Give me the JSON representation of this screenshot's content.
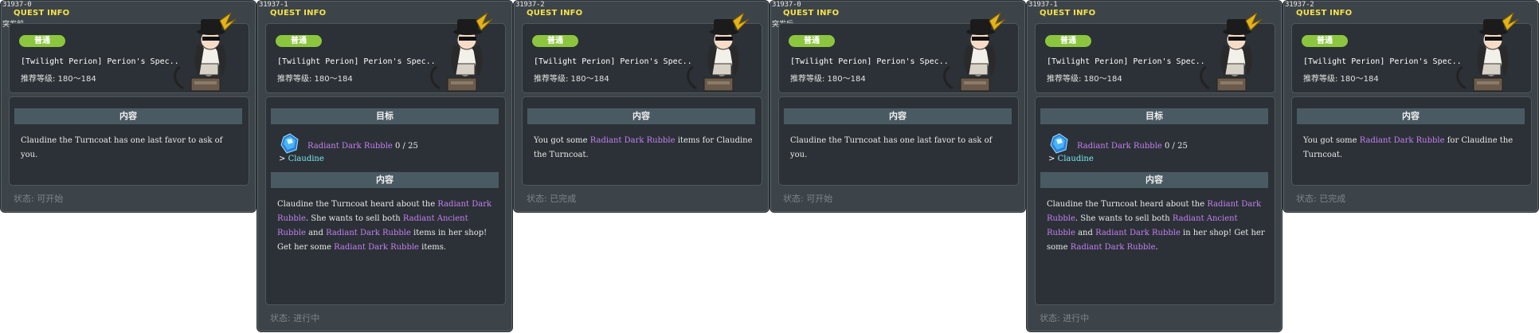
{
  "panels": [
    {
      "id": "31937-0",
      "title": "QUEST INFO",
      "tag": "突发前",
      "badge": "普通",
      "quest_name": "[Twilight Perion] Perion's Spec..",
      "level": "推荐等级: 180～184",
      "content_header": "内容",
      "description": "Claudine the Turncoat has one last favor to ask of you.",
      "status": "状态: 可开始"
    },
    {
      "id": "31937-1",
      "title": "QUEST INFO",
      "badge": "普通",
      "quest_name": "[Twilight Perion] Perion's Spec..",
      "level": "推荐等级: 180～184",
      "target_header": "目标",
      "item_name": "Radiant Dark Rubble",
      "item_count": "0 / 25",
      "npc_prefix": "> ",
      "npc_name": "Claudine",
      "content_header": "内容",
      "description_parts": [
        {
          "t": "Claudine the Turncoat heard about the ",
          "hl": false
        },
        {
          "t": "Radiant Dark Rubble",
          "hl": true
        },
        {
          "t": ". She wants to sell both ",
          "hl": false
        },
        {
          "t": "Radiant Ancient Rubble",
          "hl": true
        },
        {
          "t": " and ",
          "hl": false
        },
        {
          "t": "Radiant Dark Rubble",
          "hl": true
        },
        {
          "t": " items in her shop! Get her some ",
          "hl": false
        },
        {
          "t": "Radiant Dark Rubble",
          "hl": true
        },
        {
          "t": " items.",
          "hl": false
        }
      ],
      "status": "状态: 进行中"
    },
    {
      "id": "31937-2",
      "title": "QUEST INFO",
      "badge": "普通",
      "quest_name": "[Twilight Perion] Perion's Spec..",
      "level": "推荐等级: 180～184",
      "content_header": "内容",
      "description_parts": [
        {
          "t": "You got some ",
          "hl": false
        },
        {
          "t": "Radiant Dark Rubble",
          "hl": true
        },
        {
          "t": " items for Claudine the Turncoat.",
          "hl": false
        }
      ],
      "status": "状态: 已完成"
    },
    {
      "id": "31937-0",
      "title": "QUEST INFO",
      "tag": "突发后",
      "badge": "普通",
      "quest_name": "[Twilight Perion] Perion's Spec..",
      "level": "推荐等级: 180～184",
      "content_header": "内容",
      "description": "Claudine the Turncoat has one last favor to ask of you.",
      "status": "状态: 可开始"
    },
    {
      "id": "31937-1",
      "title": "QUEST INFO",
      "badge": "普通",
      "quest_name": "[Twilight Perion] Perion's Spec..",
      "level": "推荐等级: 180～184",
      "target_header": "目标",
      "item_name": "Radiant Dark Rubble",
      "item_count": "0 / 25",
      "npc_prefix": "> ",
      "npc_name": "Claudine",
      "content_header": "内容",
      "description_parts": [
        {
          "t": "Claudine the Turncoat heard about the ",
          "hl": false
        },
        {
          "t": "Radiant Dark Rubble",
          "hl": true
        },
        {
          "t": ". She wants to sell both ",
          "hl": false
        },
        {
          "t": "Radiant Ancient Rubble",
          "hl": true
        },
        {
          "t": " and ",
          "hl": false
        },
        {
          "t": "Radiant Dark Rubble",
          "hl": true
        },
        {
          "t": " in her shop! Get her some ",
          "hl": false
        },
        {
          "t": "Radiant Dark Rubble",
          "hl": true
        },
        {
          "t": ".",
          "hl": false
        }
      ],
      "status": "状态: 进行中"
    },
    {
      "id": "31937-2",
      "title": "QUEST INFO",
      "badge": "普通",
      "quest_name": "[Twilight Perion] Perion's Spec..",
      "level": "推荐等级: 180～184",
      "content_header": "内容",
      "description_parts": [
        {
          "t": "You got some ",
          "hl": false
        },
        {
          "t": "Radiant Dark Rubble",
          "hl": true
        },
        {
          "t": " for Claudine the Turncoat.",
          "hl": false
        }
      ],
      "status": "状态: 已完成"
    }
  ],
  "colors": {
    "title": "#f5e24a",
    "badge": "#8cc63f",
    "highlight": "#c77ff5",
    "npc_name": "#7ee7f5",
    "status": "#7e868b",
    "panel_bg": "#3d4449"
  },
  "icons": {
    "npc_portrait": "npc-portrait-icon",
    "item": "rubble-crystal-icon"
  }
}
